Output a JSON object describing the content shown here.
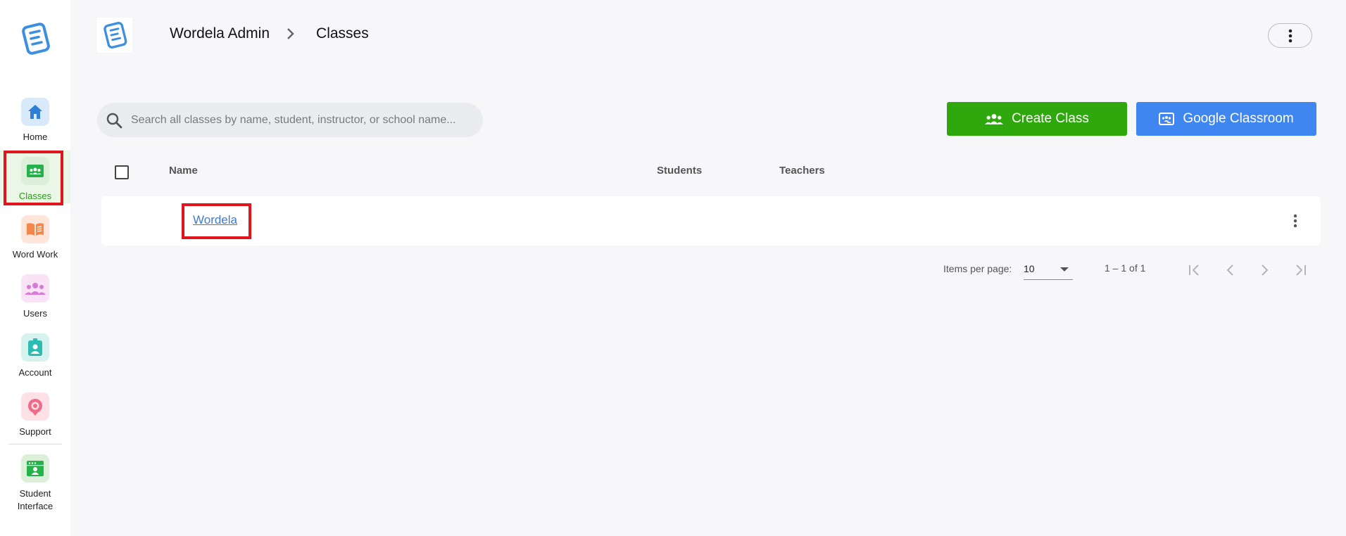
{
  "sidebar": {
    "items": [
      {
        "label": "Home",
        "icon": "home-icon",
        "color": "#2f7fd6",
        "bg": "#d8eafa"
      },
      {
        "label": "Classes",
        "icon": "classes-icon",
        "color": "#26b24b",
        "bg": "#dcefd8",
        "active": true
      },
      {
        "label": "Word Work",
        "icon": "book-icon",
        "color": "#f2894c",
        "bg": "#fde6d9"
      },
      {
        "label": "Users",
        "icon": "users-icon",
        "color": "#d77bd4",
        "bg": "#f8e3f7"
      },
      {
        "label": "Account",
        "icon": "account-icon",
        "color": "#2cbcb1",
        "bg": "#d6f2ef"
      },
      {
        "label": "Support",
        "icon": "support-icon",
        "color": "#f06a8a",
        "bg": "#fde1e6"
      },
      {
        "label": "Student Interface",
        "label_line1": "Student",
        "label_line2": "Interface",
        "icon": "student-interface-icon",
        "color": "#26b24b",
        "bg": "#dcefd8"
      }
    ]
  },
  "header": {
    "breadcrumb_root": "Wordela Admin",
    "breadcrumb_current": "Classes"
  },
  "search": {
    "placeholder": "Search all classes by name, student, instructor, or school name..."
  },
  "actions": {
    "create_label": "Create Class",
    "google_label": "Google Classroom"
  },
  "table": {
    "columns": {
      "name": "Name",
      "students": "Students",
      "teachers": "Teachers"
    },
    "rows": [
      {
        "name": "Wordela",
        "students": "",
        "teachers": ""
      }
    ]
  },
  "pagination": {
    "items_per_page_label": "Items per page:",
    "items_per_page": "10",
    "range": "1 – 1 of 1"
  },
  "colors": {
    "accent_green": "#2ea80c",
    "accent_blue": "#3f86f0",
    "highlight": "#e0161e",
    "link": "#3a7bd5"
  }
}
